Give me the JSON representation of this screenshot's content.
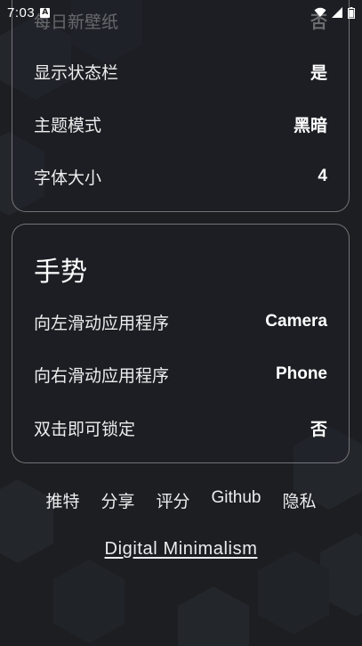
{
  "status_bar": {
    "time": "7:03",
    "notification_badge": "A",
    "icons": [
      "wifi-icon",
      "signal-icon",
      "battery-icon"
    ]
  },
  "settings": {
    "daily_wallpaper": {
      "label": "每日新壁纸",
      "value": "否"
    },
    "show_status_bar": {
      "label": "显示状态栏",
      "value": "是"
    },
    "theme_mode": {
      "label": "主题模式",
      "value": "黑暗"
    },
    "font_size": {
      "label": "字体大小",
      "value": "4"
    }
  },
  "gestures": {
    "title": "手势",
    "swipe_left": {
      "label": "向左滑动应用程序",
      "value": "Camera"
    },
    "swipe_right": {
      "label": "向右滑动应用程序",
      "value": "Phone"
    },
    "double_tap_lock": {
      "label": "双击即可锁定",
      "value": "否"
    }
  },
  "links": {
    "twitter": "推特",
    "share": "分享",
    "rate": "评分",
    "github": "Github",
    "privacy": "隐私"
  },
  "footer": "Digital Minimalism",
  "colors": {
    "background": "#1c1e22",
    "card_border": "#6a6c70",
    "text": "#ffffff"
  }
}
